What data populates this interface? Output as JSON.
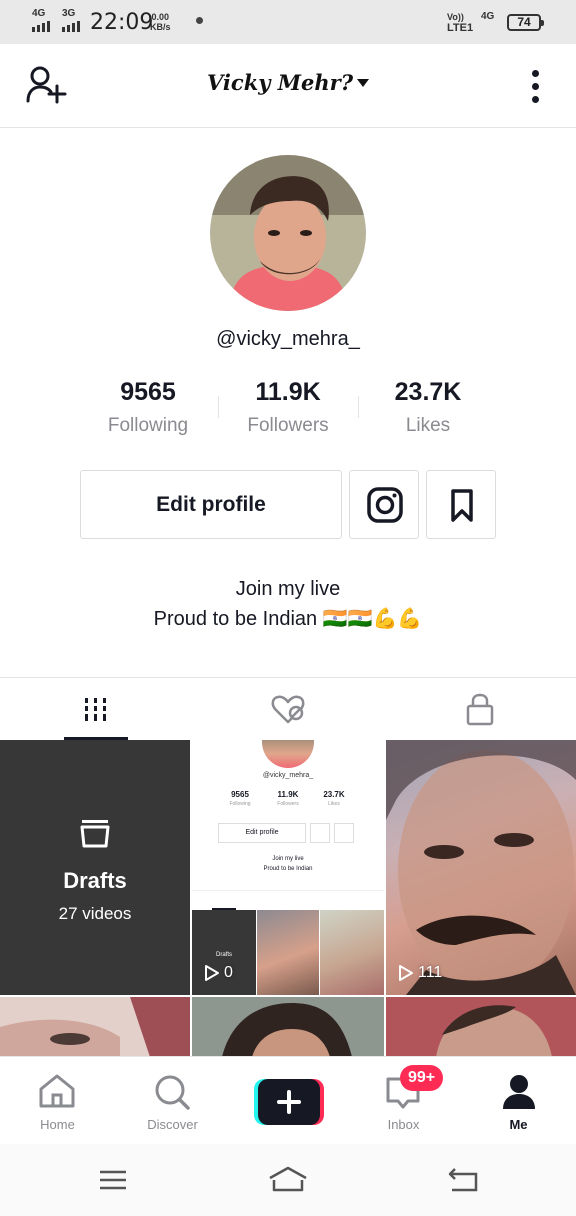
{
  "status_bar": {
    "network_1": "4G",
    "network_2": "3G",
    "time": "22:09",
    "speed_value": "0.00",
    "speed_unit": "KB/s",
    "volte": "Vo))",
    "lte": "LTE1",
    "network_right": "4G",
    "battery": "74"
  },
  "header": {
    "username": "Vicky Mehr?"
  },
  "profile": {
    "handle": "@vicky_mehra_",
    "stats": [
      {
        "value": "9565",
        "label": "Following"
      },
      {
        "value": "11.9K",
        "label": "Followers"
      },
      {
        "value": "23.7K",
        "label": "Likes"
      }
    ],
    "edit_label": "Edit profile",
    "bio_line_1": "Join my live",
    "bio_line_2": "Proud to be Indian",
    "bio_emoji": "🇮🇳🇮🇳💪💪"
  },
  "grid": {
    "drafts_title": "Drafts",
    "drafts_count": "27 videos",
    "thumb_2_views": "0",
    "thumb_3_views": "111",
    "mini": {
      "handle": "@vicky_mehra_",
      "stats": [
        {
          "value": "9565",
          "label": "Following"
        },
        {
          "value": "11.9K",
          "label": "Followers"
        },
        {
          "value": "23.7K",
          "label": "Likes"
        }
      ],
      "edit_label": "Edit profile",
      "bio_line_1": "Join my live",
      "bio_line_2": "Proud to be Indian",
      "drafts_label": "Drafts"
    }
  },
  "bottom_nav": {
    "home": "Home",
    "discover": "Discover",
    "inbox": "Inbox",
    "inbox_badge": "99+",
    "me": "Me"
  },
  "colors": {
    "accent_red": "#fe2c55",
    "accent_cyan": "#25f4ee",
    "text_primary": "#161823",
    "text_secondary": "#8a8b91"
  }
}
